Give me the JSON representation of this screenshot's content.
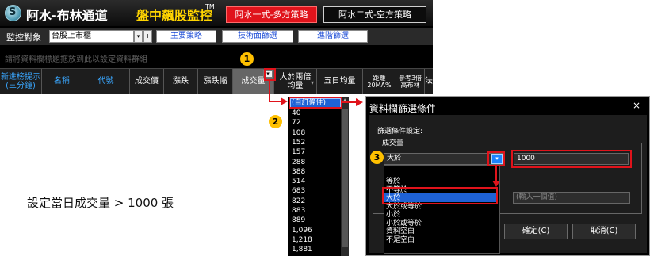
{
  "app": {
    "logo_glyph": "S",
    "title": "阿水-布林通道",
    "subtitle": "盤中飆股監控",
    "tm": "TM",
    "strategy_tabs": [
      "阿水一式-多方策略",
      "阿水二式-空方策略"
    ]
  },
  "controls": {
    "monitor_label": "監控對象",
    "market_value": "台股上市櫃",
    "dropdown_glyph": "▾",
    "plus_glyph": "+",
    "nav": [
      "主要策略",
      "技術面篩選",
      "進階篩選"
    ]
  },
  "hint_text": "請將資料欄標題拖放到此以設定資料群組",
  "columns": {
    "new_signal": "新進榜提示\n(三分鐘)",
    "name": "名稱",
    "code": "代號",
    "price": "成交價",
    "change": "漲跌",
    "change_pct": "漲跌幅",
    "volume": "成交量",
    "above_ma": "大於兩倍\n均量",
    "ma5_volume": "五日均量",
    "distance": "距離\n20MA%",
    "ref_bb": "參考3倍\n高布林",
    "method": "法"
  },
  "value_list": {
    "items": [
      "(自訂條件)",
      "40",
      "72",
      "108",
      "152",
      "157",
      "288",
      "388",
      "514",
      "683",
      "822",
      "883",
      "889",
      "1,096",
      "1,218",
      "1,881"
    ]
  },
  "dialog": {
    "title": "資料欄篩選條件",
    "close_glyph": "×",
    "settings_label": "篩選條件設定:",
    "field_label": "成交量",
    "condition_value": "大於",
    "value_input": "1000",
    "second_placeholder": "(輸入一個值)",
    "condition_options": [
      "等於",
      "不等於",
      "大於",
      "大於或等於",
      "小於",
      "小於或等於",
      "資料空白",
      "不是空白"
    ],
    "selected_option_index": 2,
    "ok_label": "確定(C)",
    "cancel_label": "取消(C)"
  },
  "annotations": {
    "badges": [
      "1",
      "2",
      "3"
    ],
    "caption": "設定當日成交量 > 1000 張"
  },
  "colors": {
    "accent_red": "#e0131b",
    "badge_yellow": "#ffc000",
    "title_yellow": "#ffd400",
    "select_blue": "#1e62d6",
    "column_blue": "#3aa7ff"
  }
}
